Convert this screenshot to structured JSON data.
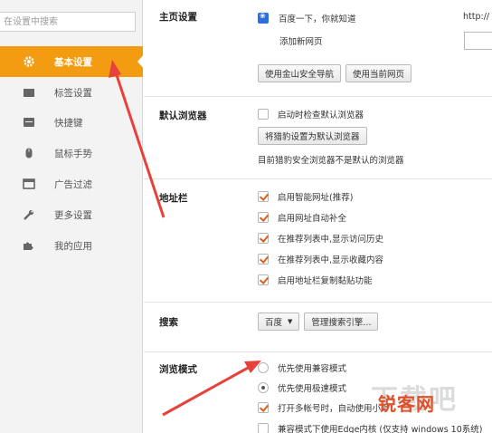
{
  "search": {
    "placeholder": "在设置中搜索"
  },
  "sidebar": {
    "items": [
      {
        "label": "基本设置",
        "icon": "gear-icon"
      },
      {
        "label": "标签设置",
        "icon": "tab-icon"
      },
      {
        "label": "快捷键",
        "icon": "keyboard-icon"
      },
      {
        "label": "鼠标手势",
        "icon": "mouse-icon"
      },
      {
        "label": "广告过滤",
        "icon": "window-icon"
      },
      {
        "label": "更多设置",
        "icon": "wrench-icon"
      },
      {
        "label": "我的应用",
        "icon": "puzzle-icon"
      }
    ]
  },
  "home": {
    "title": "主页设置",
    "page_name": "百度一下，你就知道",
    "url_fragment": "http://",
    "add_new": "添加新网页",
    "btn_jinshan": "使用金山安全导航",
    "btn_current": "使用当前网页"
  },
  "default_browser": {
    "title": "默认浏览器",
    "check_label": "启动时检查默认浏览器",
    "set_default_btn": "将猎豹设置为默认浏览器",
    "note": "目前猎豹安全浏览器不是默认的浏览器"
  },
  "address_bar": {
    "title": "地址栏",
    "options": [
      "启用智能网址(推荐)",
      "启用网址自动补全",
      "在推荐列表中,显示访问历史",
      "在推荐列表中,显示收藏内容",
      "启用地址栏复制黏贴功能"
    ]
  },
  "search_section": {
    "title": "搜索",
    "engine": "百度",
    "manage_btn": "管理搜索引擎..."
  },
  "browse_mode": {
    "title": "浏览模式",
    "compat": "优先使用兼容模式",
    "speed": "优先使用极速模式",
    "multi_account": "打开多帐号时，自动使用小号",
    "edge_kernel": "兼容模式下使用Edge内核 (仅支持 windows 10系统)"
  },
  "watermark": {
    "main": "锐客网",
    "bg": "下载吧"
  },
  "colors": {
    "accent": "#f39c12",
    "arrow": "#e8413b"
  }
}
